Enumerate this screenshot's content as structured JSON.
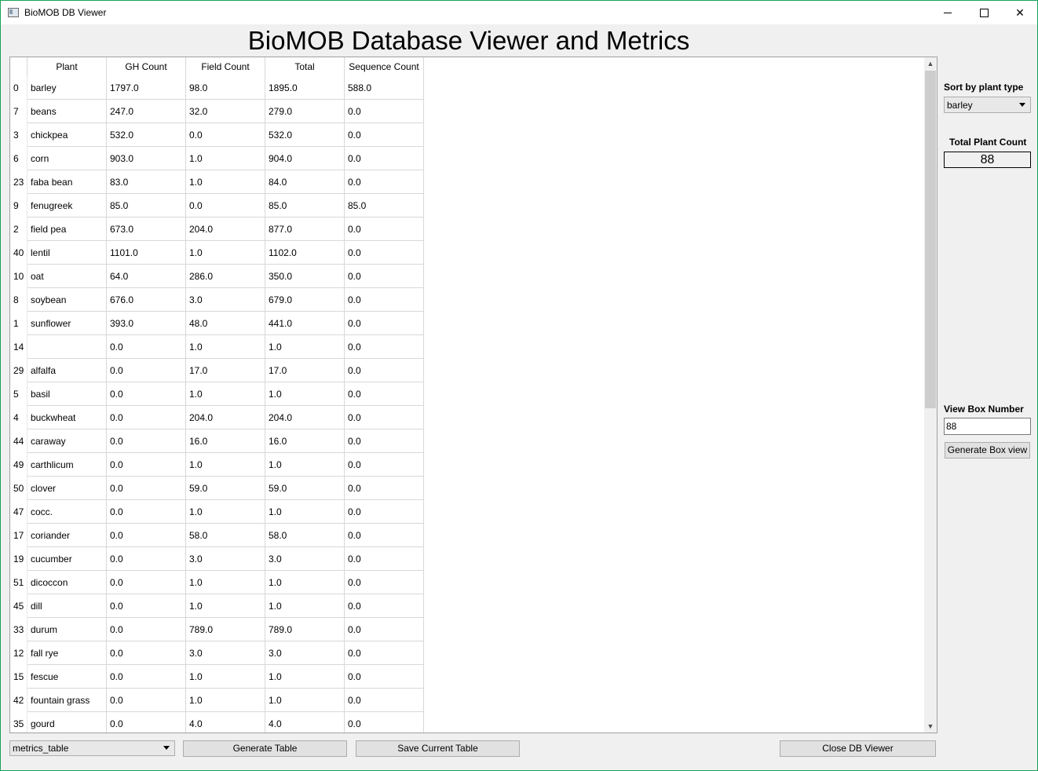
{
  "window": {
    "title": "BioMOB DB Viewer",
    "min_glyph": "—",
    "max_glyph": "☐",
    "close_glyph": "✕"
  },
  "heading": "BioMOB Database Viewer and Metrics",
  "table": {
    "columns": [
      "Plant",
      "GH Count",
      "Field Count",
      "Total",
      "Sequence Count"
    ],
    "rows": [
      {
        "index": "0",
        "plant": "barley",
        "gh": "1797.0",
        "field": "98.0",
        "total": "1895.0",
        "seq": "588.0"
      },
      {
        "index": "7",
        "plant": "beans",
        "gh": "247.0",
        "field": "32.0",
        "total": "279.0",
        "seq": "0.0"
      },
      {
        "index": "3",
        "plant": "chickpea",
        "gh": "532.0",
        "field": "0.0",
        "total": "532.0",
        "seq": "0.0"
      },
      {
        "index": "6",
        "plant": "corn",
        "gh": "903.0",
        "field": "1.0",
        "total": "904.0",
        "seq": "0.0"
      },
      {
        "index": "23",
        "plant": "faba bean",
        "gh": "83.0",
        "field": "1.0",
        "total": "84.0",
        "seq": "0.0"
      },
      {
        "index": "9",
        "plant": "fenugreek",
        "gh": "85.0",
        "field": "0.0",
        "total": "85.0",
        "seq": "85.0"
      },
      {
        "index": "2",
        "plant": "field pea",
        "gh": "673.0",
        "field": "204.0",
        "total": "877.0",
        "seq": "0.0"
      },
      {
        "index": "40",
        "plant": "lentil",
        "gh": "1101.0",
        "field": "1.0",
        "total": "1102.0",
        "seq": "0.0"
      },
      {
        "index": "10",
        "plant": "oat",
        "gh": "64.0",
        "field": "286.0",
        "total": "350.0",
        "seq": "0.0"
      },
      {
        "index": "8",
        "plant": "soybean",
        "gh": "676.0",
        "field": "3.0",
        "total": "679.0",
        "seq": "0.0"
      },
      {
        "index": "1",
        "plant": "sunflower",
        "gh": "393.0",
        "field": "48.0",
        "total": "441.0",
        "seq": "0.0"
      },
      {
        "index": "14",
        "plant": "",
        "gh": "0.0",
        "field": "1.0",
        "total": "1.0",
        "seq": "0.0"
      },
      {
        "index": "29",
        "plant": "alfalfa",
        "gh": "0.0",
        "field": "17.0",
        "total": "17.0",
        "seq": "0.0"
      },
      {
        "index": "5",
        "plant": "basil",
        "gh": "0.0",
        "field": "1.0",
        "total": "1.0",
        "seq": "0.0"
      },
      {
        "index": "4",
        "plant": "buckwheat",
        "gh": "0.0",
        "field": "204.0",
        "total": "204.0",
        "seq": "0.0"
      },
      {
        "index": "44",
        "plant": "caraway",
        "gh": "0.0",
        "field": "16.0",
        "total": "16.0",
        "seq": "0.0"
      },
      {
        "index": "49",
        "plant": "carthlicum",
        "gh": "0.0",
        "field": "1.0",
        "total": "1.0",
        "seq": "0.0"
      },
      {
        "index": "50",
        "plant": "clover",
        "gh": "0.0",
        "field": "59.0",
        "total": "59.0",
        "seq": "0.0"
      },
      {
        "index": "47",
        "plant": "cocc.",
        "gh": "0.0",
        "field": "1.0",
        "total": "1.0",
        "seq": "0.0"
      },
      {
        "index": "17",
        "plant": "coriander",
        "gh": "0.0",
        "field": "58.0",
        "total": "58.0",
        "seq": "0.0"
      },
      {
        "index": "19",
        "plant": "cucumber",
        "gh": "0.0",
        "field": "3.0",
        "total": "3.0",
        "seq": "0.0"
      },
      {
        "index": "51",
        "plant": "dicoccon",
        "gh": "0.0",
        "field": "1.0",
        "total": "1.0",
        "seq": "0.0"
      },
      {
        "index": "45",
        "plant": "dill",
        "gh": "0.0",
        "field": "1.0",
        "total": "1.0",
        "seq": "0.0"
      },
      {
        "index": "33",
        "plant": "durum",
        "gh": "0.0",
        "field": "789.0",
        "total": "789.0",
        "seq": "0.0"
      },
      {
        "index": "12",
        "plant": "fall rye",
        "gh": "0.0",
        "field": "3.0",
        "total": "3.0",
        "seq": "0.0"
      },
      {
        "index": "15",
        "plant": "fescue",
        "gh": "0.0",
        "field": "1.0",
        "total": "1.0",
        "seq": "0.0"
      },
      {
        "index": "42",
        "plant": "fountain grass",
        "gh": "0.0",
        "field": "1.0",
        "total": "1.0",
        "seq": "0.0"
      },
      {
        "index": "35",
        "plant": "gourd",
        "gh": "0.0",
        "field": "4.0",
        "total": "4.0",
        "seq": "0.0"
      }
    ]
  },
  "sidebar": {
    "sort_label": "Sort by plant type",
    "sort_value": "barley",
    "total_label": "Total Plant Count",
    "total_value": "88",
    "box_label": "View Box Number",
    "box_value": "88",
    "generate_box_label": "Generate Box view"
  },
  "bottom": {
    "table_select_value": "metrics_table",
    "generate_table_label": "Generate Table",
    "save_table_label": "Save Current Table",
    "close_label": "Close DB Viewer"
  }
}
